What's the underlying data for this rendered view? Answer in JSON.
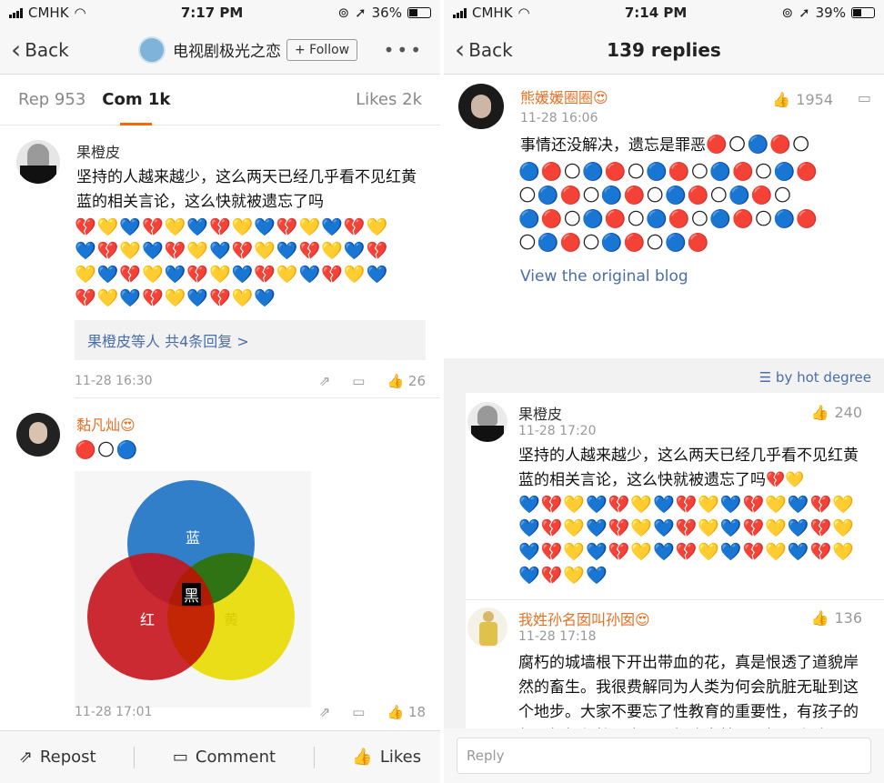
{
  "left": {
    "status": {
      "carrier": "CMHK",
      "time": "7:17 PM",
      "battery": "36%",
      "battery_level": 0.36
    },
    "nav": {
      "back": "Back",
      "title": "电视剧极光之恋",
      "follow": "+ Follow"
    },
    "tabs": {
      "reposts": "Rep 953",
      "comments": "Com 1k",
      "likes": "Likes 2k"
    },
    "comments": [
      {
        "name": "果橙皮",
        "text": "坚持的人越来越少，这么两天已经几乎看不见红黄蓝的相关言论，这么快就被遗忘了吗",
        "emojis": [
          "💔💛💙💔💛💙💔💛💙💔💛💙💔💛",
          "💙💔💛💙💔💛💙💔💛💙💔💛💙💔",
          "💛💙💔💛💙💔💛💙💔💛💙💔💛💙",
          "💔💛💙💔💛💙💔💛💙"
        ],
        "subreplies": "果橙皮等人  共4条回复 >",
        "time": "11-28 16:30",
        "likes": "26"
      },
      {
        "name": "黏凡灿",
        "badge": "😍",
        "emojis": "🔴🌕🔵",
        "time": "11-28 17:01",
        "likes": "18",
        "venn": {
          "blue": "蓝",
          "red": "红",
          "yellow": "黄",
          "center": "黑"
        }
      }
    ],
    "bottom": {
      "repost": "Repost",
      "comment": "Comment",
      "likes": "Likes"
    }
  },
  "right": {
    "status": {
      "carrier": "CMHK",
      "time": "7:14 PM",
      "battery": "39%",
      "battery_level": 0.39
    },
    "nav": {
      "back": "Back",
      "title": "139 replies"
    },
    "blog": {
      "name": "熊媛媛圈圈",
      "badge": "😍",
      "time": "11-28 16:06",
      "likes": "1954",
      "text": "事情还没解决，遗忘是罪恶",
      "first_line_emojis": "🔴🌕🔵🔴🌕",
      "emojis": [
        "🔵🔴🌕🔵🔴🌕🔵🔴🌕🔵🔴🌕🔵🔴",
        "🌕🔵🔴🌕🔵🔴🌕🔵🔴🌕🔵🔴🌕",
        "🔵🔴🌕🔵🔴🌕🔵🔴🌕🔵🔴🌕🔵🔴",
        "🌕🔵🔴🌕🔵🔴🌕🔵🔴"
      ],
      "view": "View the original blog"
    },
    "sort": "by hot degree",
    "replies": [
      {
        "name": "果橙皮",
        "time": "11-28 17:20",
        "likes": "240",
        "text": "坚持的人越来越少，这么两天已经几乎看不见红黄蓝的相关言论，这么快就被遗忘了吗💔💛",
        "emojis": [
          "💙💔💛💙💔💛💙💔💛💙💔💛💙💔💛",
          "💙💔💛💙💔💛💙💔💛💙💔💛💙💔💛",
          "💙💔💛💙💔💛💙💔💛💙💔💛💙💔💛",
          "💙💔💛💙"
        ]
      },
      {
        "name": "我姓孙名囡叫孙囡",
        "badge": "😍",
        "time": "11-28 17:18",
        "likes": "136",
        "text": "腐朽的城墙根下开出带血的花，真是恨透了道貌岸然的畜生。我很费解同为人类为何会肮脏无耻到这个地步。大家不要忘了性教育的重要性，有孩子的都要好好保护，少了一根头发就可以提刀上阵了。❤️💛💙"
      }
    ],
    "reply_placeholder": "Reply"
  }
}
